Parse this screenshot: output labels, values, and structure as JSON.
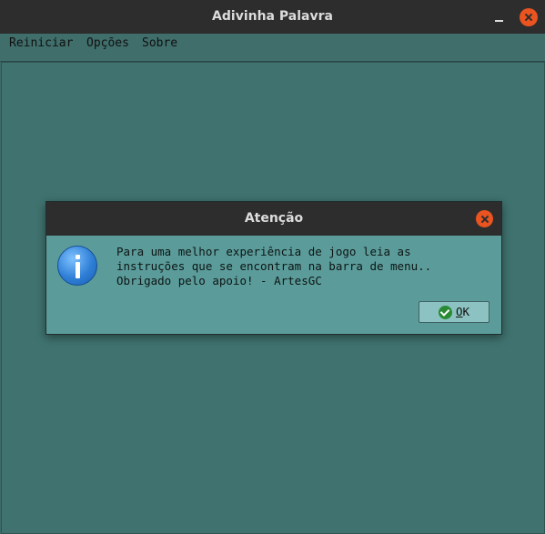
{
  "window": {
    "title": "Adivinha Palavra"
  },
  "menu": {
    "items": [
      "Reiniciar",
      "Opções",
      "Sobre"
    ]
  },
  "dialog": {
    "title": "Atenção",
    "message": "Para uma melhor experiência de jogo leia as\ninstruções que se encontram na barra de menu..\nObrigado pelo apoio! - ArtesGC",
    "ok_mnemonic": "O",
    "ok_rest": "K"
  },
  "colors": {
    "accent_close": "#e95420",
    "titlebar": "#2d2d2d",
    "dialog_bg": "#5b9c9a",
    "window_bg": "#407370"
  }
}
